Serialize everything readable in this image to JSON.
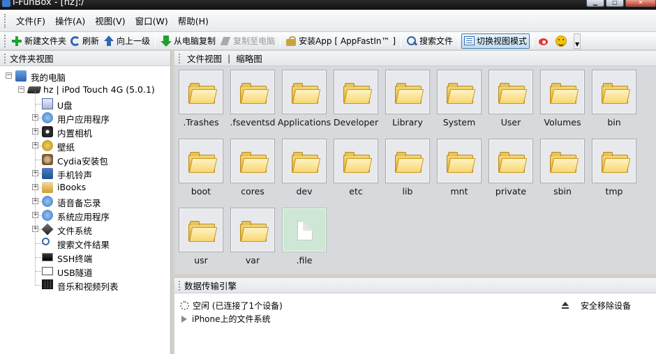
{
  "window": {
    "title": "i-FunBox - [hz]:/"
  },
  "menu": [
    "文件(F)",
    "操作(A)",
    "视图(V)",
    "窗口(W)",
    "帮助(H)"
  ],
  "toolbar": {
    "new_folder": "新建文件夹",
    "refresh": "刷新",
    "up": "向上一级",
    "copy_from_pc": "从电脑复制",
    "copy_to_pc": "复制至电脑",
    "install_app": "安装App [ AppFastIn™ ]",
    "search": "搜索文件",
    "switch_view": "切换视图模式"
  },
  "left_panel": {
    "title": "文件夹视图",
    "root": "我的电脑",
    "device": "hz | iPod Touch 4G (5.0.1)",
    "items": [
      {
        "label": "U盘",
        "icon": "udisk-icon",
        "expandable": false
      },
      {
        "label": "用户应用程序",
        "icon": "app-icon",
        "expandable": true
      },
      {
        "label": "内置相机",
        "icon": "camera-icon",
        "expandable": true
      },
      {
        "label": "壁纸",
        "icon": "wallpaper-icon",
        "expandable": true
      },
      {
        "label": "Cydia安装包",
        "icon": "cydia-icon",
        "expandable": false
      },
      {
        "label": "手机铃声",
        "icon": "ringtone-icon",
        "expandable": true
      },
      {
        "label": "iBooks",
        "icon": "ibooks-icon",
        "expandable": true
      },
      {
        "label": "语音备忘录",
        "icon": "voice-memo-icon",
        "expandable": true
      },
      {
        "label": "系统应用程序",
        "icon": "system-app-icon",
        "expandable": true
      },
      {
        "label": "文件系统",
        "icon": "filesystem-icon",
        "expandable": true
      },
      {
        "label": "搜索文件结果",
        "icon": "search-results-icon",
        "expandable": false
      },
      {
        "label": "SSH终端",
        "icon": "ssh-terminal-icon",
        "expandable": false
      },
      {
        "label": "USB隧道",
        "icon": "usb-tunnel-icon",
        "expandable": false
      },
      {
        "label": "音乐和视频列表",
        "icon": "media-list-icon",
        "expandable": false
      }
    ]
  },
  "file_panel": {
    "tabs": [
      "文件视图",
      "缩略图"
    ],
    "tab_separator": "|",
    "items": [
      {
        "name": ".Trashes",
        "type": "folder"
      },
      {
        "name": ".fseventsd",
        "type": "folder"
      },
      {
        "name": "Applications",
        "type": "folder"
      },
      {
        "name": "Developer",
        "type": "folder"
      },
      {
        "name": "Library",
        "type": "folder"
      },
      {
        "name": "System",
        "type": "folder"
      },
      {
        "name": "User",
        "type": "folder"
      },
      {
        "name": "Volumes",
        "type": "folder"
      },
      {
        "name": "bin",
        "type": "folder"
      },
      {
        "name": "boot",
        "type": "folder"
      },
      {
        "name": "cores",
        "type": "folder"
      },
      {
        "name": "dev",
        "type": "folder"
      },
      {
        "name": "etc",
        "type": "folder"
      },
      {
        "name": "lib",
        "type": "folder"
      },
      {
        "name": "mnt",
        "type": "folder"
      },
      {
        "name": "private",
        "type": "folder"
      },
      {
        "name": "sbin",
        "type": "folder"
      },
      {
        "name": "tmp",
        "type": "folder"
      },
      {
        "name": "usr",
        "type": "folder"
      },
      {
        "name": "var",
        "type": "folder"
      },
      {
        "name": ".file",
        "type": "file"
      }
    ]
  },
  "transfer_panel": {
    "title": "数据传输引擎",
    "status": "空闲 (已连接了1个设备)",
    "safe_remove": "安全移除设备",
    "device_fs": "iPhone上的文件系统"
  }
}
